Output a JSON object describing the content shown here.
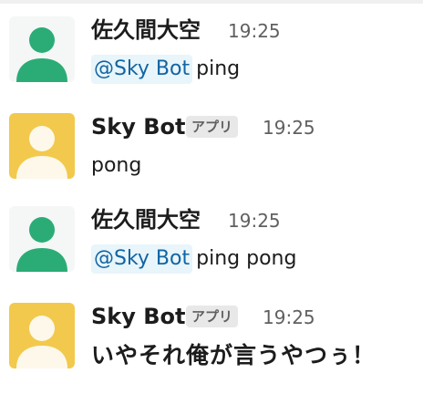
{
  "messages": [
    {
      "sender": "佐久間大空",
      "time": "19:25",
      "mention": "@Sky Bot",
      "text": "ping",
      "avatar": "user-avatar-icon",
      "avatar_bg": "#f4f7f6",
      "avatar_fg": "#2bac76"
    },
    {
      "sender": "Sky Bot",
      "badge": "アプリ",
      "time": "19:25",
      "text": "pong",
      "avatar": "bot-avatar-icon",
      "avatar_bg": "#f2c94c",
      "avatar_fg": "#fdf8ea"
    },
    {
      "sender": "佐久間大空",
      "time": "19:25",
      "mention": "@Sky Bot",
      "text": "ping pong",
      "avatar": "user-avatar-icon",
      "avatar_bg": "#f4f7f6",
      "avatar_fg": "#2bac76"
    },
    {
      "sender": "Sky Bot",
      "badge": "アプリ",
      "time": "19:25",
      "text": "いやそれ俺が言うやつぅ！",
      "avatar": "bot-avatar-icon",
      "avatar_bg": "#f2c94c",
      "avatar_fg": "#fdf8ea"
    }
  ]
}
